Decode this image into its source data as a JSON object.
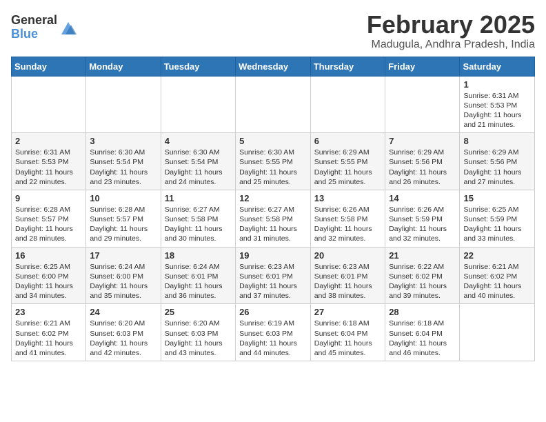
{
  "header": {
    "logo_general": "General",
    "logo_blue": "Blue",
    "main_title": "February 2025",
    "subtitle": "Madugula, Andhra Pradesh, India"
  },
  "calendar": {
    "headers": [
      "Sunday",
      "Monday",
      "Tuesday",
      "Wednesday",
      "Thursday",
      "Friday",
      "Saturday"
    ],
    "weeks": [
      [
        {
          "day": "",
          "info": ""
        },
        {
          "day": "",
          "info": ""
        },
        {
          "day": "",
          "info": ""
        },
        {
          "day": "",
          "info": ""
        },
        {
          "day": "",
          "info": ""
        },
        {
          "day": "",
          "info": ""
        },
        {
          "day": "1",
          "info": "Sunrise: 6:31 AM\nSunset: 5:53 PM\nDaylight: 11 hours and 21 minutes."
        }
      ],
      [
        {
          "day": "2",
          "info": "Sunrise: 6:31 AM\nSunset: 5:53 PM\nDaylight: 11 hours and 22 minutes."
        },
        {
          "day": "3",
          "info": "Sunrise: 6:30 AM\nSunset: 5:54 PM\nDaylight: 11 hours and 23 minutes."
        },
        {
          "day": "4",
          "info": "Sunrise: 6:30 AM\nSunset: 5:54 PM\nDaylight: 11 hours and 24 minutes."
        },
        {
          "day": "5",
          "info": "Sunrise: 6:30 AM\nSunset: 5:55 PM\nDaylight: 11 hours and 25 minutes."
        },
        {
          "day": "6",
          "info": "Sunrise: 6:29 AM\nSunset: 5:55 PM\nDaylight: 11 hours and 25 minutes."
        },
        {
          "day": "7",
          "info": "Sunrise: 6:29 AM\nSunset: 5:56 PM\nDaylight: 11 hours and 26 minutes."
        },
        {
          "day": "8",
          "info": "Sunrise: 6:29 AM\nSunset: 5:56 PM\nDaylight: 11 hours and 27 minutes."
        }
      ],
      [
        {
          "day": "9",
          "info": "Sunrise: 6:28 AM\nSunset: 5:57 PM\nDaylight: 11 hours and 28 minutes."
        },
        {
          "day": "10",
          "info": "Sunrise: 6:28 AM\nSunset: 5:57 PM\nDaylight: 11 hours and 29 minutes."
        },
        {
          "day": "11",
          "info": "Sunrise: 6:27 AM\nSunset: 5:58 PM\nDaylight: 11 hours and 30 minutes."
        },
        {
          "day": "12",
          "info": "Sunrise: 6:27 AM\nSunset: 5:58 PM\nDaylight: 11 hours and 31 minutes."
        },
        {
          "day": "13",
          "info": "Sunrise: 6:26 AM\nSunset: 5:58 PM\nDaylight: 11 hours and 32 minutes."
        },
        {
          "day": "14",
          "info": "Sunrise: 6:26 AM\nSunset: 5:59 PM\nDaylight: 11 hours and 32 minutes."
        },
        {
          "day": "15",
          "info": "Sunrise: 6:25 AM\nSunset: 5:59 PM\nDaylight: 11 hours and 33 minutes."
        }
      ],
      [
        {
          "day": "16",
          "info": "Sunrise: 6:25 AM\nSunset: 6:00 PM\nDaylight: 11 hours and 34 minutes."
        },
        {
          "day": "17",
          "info": "Sunrise: 6:24 AM\nSunset: 6:00 PM\nDaylight: 11 hours and 35 minutes."
        },
        {
          "day": "18",
          "info": "Sunrise: 6:24 AM\nSunset: 6:01 PM\nDaylight: 11 hours and 36 minutes."
        },
        {
          "day": "19",
          "info": "Sunrise: 6:23 AM\nSunset: 6:01 PM\nDaylight: 11 hours and 37 minutes."
        },
        {
          "day": "20",
          "info": "Sunrise: 6:23 AM\nSunset: 6:01 PM\nDaylight: 11 hours and 38 minutes."
        },
        {
          "day": "21",
          "info": "Sunrise: 6:22 AM\nSunset: 6:02 PM\nDaylight: 11 hours and 39 minutes."
        },
        {
          "day": "22",
          "info": "Sunrise: 6:21 AM\nSunset: 6:02 PM\nDaylight: 11 hours and 40 minutes."
        }
      ],
      [
        {
          "day": "23",
          "info": "Sunrise: 6:21 AM\nSunset: 6:02 PM\nDaylight: 11 hours and 41 minutes."
        },
        {
          "day": "24",
          "info": "Sunrise: 6:20 AM\nSunset: 6:03 PM\nDaylight: 11 hours and 42 minutes."
        },
        {
          "day": "25",
          "info": "Sunrise: 6:20 AM\nSunset: 6:03 PM\nDaylight: 11 hours and 43 minutes."
        },
        {
          "day": "26",
          "info": "Sunrise: 6:19 AM\nSunset: 6:03 PM\nDaylight: 11 hours and 44 minutes."
        },
        {
          "day": "27",
          "info": "Sunrise: 6:18 AM\nSunset: 6:04 PM\nDaylight: 11 hours and 45 minutes."
        },
        {
          "day": "28",
          "info": "Sunrise: 6:18 AM\nSunset: 6:04 PM\nDaylight: 11 hours and 46 minutes."
        },
        {
          "day": "",
          "info": ""
        }
      ]
    ]
  }
}
